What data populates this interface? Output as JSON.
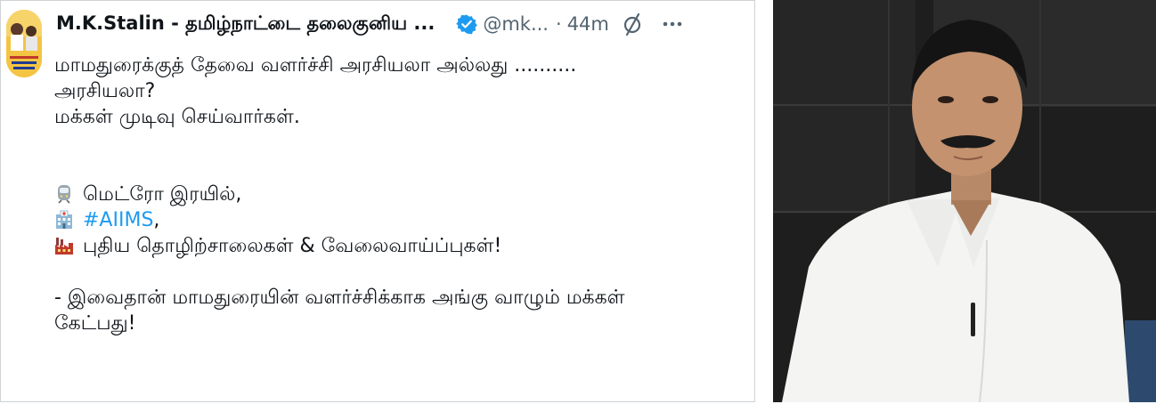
{
  "tweet": {
    "display_name": "M.K.Stalin - தமிழ்நாட்டை தலைகுனிய ...",
    "handle": "@mk...",
    "separator": "·",
    "time": "44m",
    "body": {
      "line1": "மாமதுரைக்குத் தேவை வளர்ச்சி அரசியலா அல்லது ..........",
      "line2": "அரசியலா?",
      "line3": "மக்கள் முடிவு செய்வார்கள்.",
      "item1": "மெட்ரோ இரயில்,",
      "item2_hashtag": "#AIIMS",
      "item2_suffix": ",",
      "item3": "புதிய தொழிற்சாலைகள் & வேலைவாய்ப்புகள்!",
      "closing1": "- இவைதான் மாமதுரையின் வளர்ச்சிக்காக அங்கு வாழும் மக்கள்",
      "closing2": "கேட்பது!"
    },
    "icons": {
      "verified": "verified-badge-icon",
      "stats": "no-stats-icon",
      "more": "more-options-icon",
      "item1": "metro-train-icon",
      "item2": "hospital-icon",
      "item3": "factory-icon"
    }
  },
  "colors": {
    "text": "#0f1419",
    "secondary": "#536471",
    "link": "#1d9bf0",
    "verified": "#1d9bf0"
  }
}
